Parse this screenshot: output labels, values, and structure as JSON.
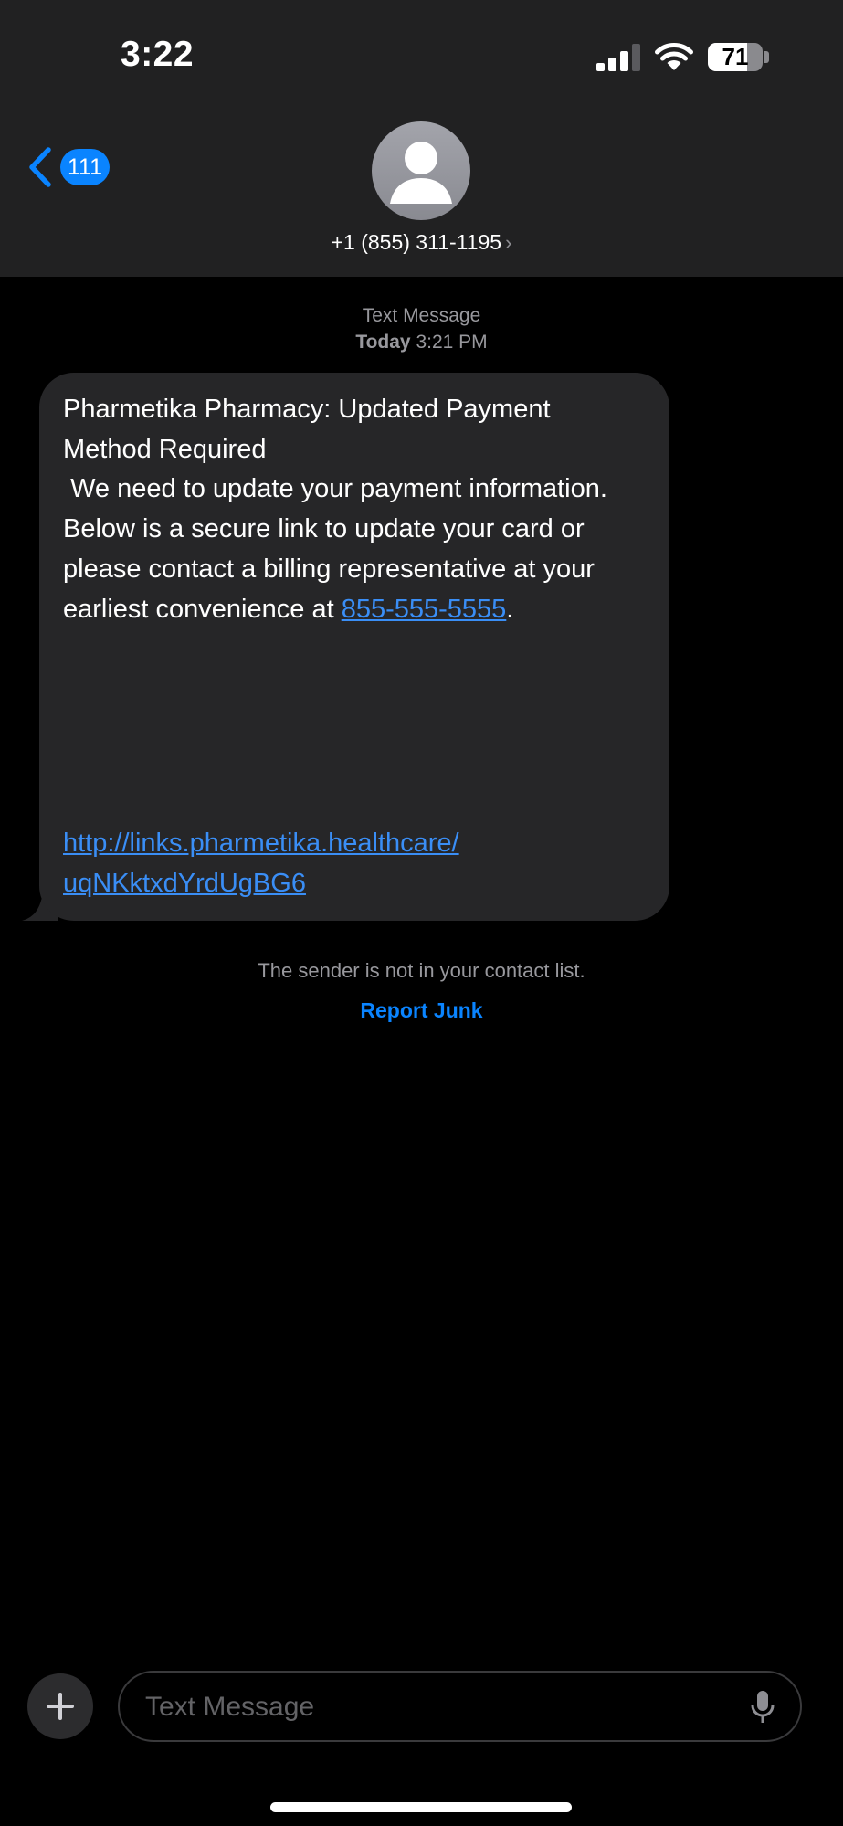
{
  "status_bar": {
    "time": "3:22",
    "battery_level": "71",
    "battery_fraction": 0.71,
    "signal_bars_active": 3,
    "signal_bars_total": 4
  },
  "nav": {
    "back_badge": "111",
    "contact_number": "+1 (855) 311-1195",
    "chevron": "›"
  },
  "conversation": {
    "service": "Text Message",
    "date_label": "Today",
    "time_label": "3:21 PM",
    "message": {
      "line_1": "Pharmetika Pharmacy: Updated Payment Method Required\n We need to update your payment information.  Below is a secure link to update your card or please contact a billing representative at your earliest convenience at ",
      "phone_link": "855-555-5555",
      "after_phone": ".",
      "url_part_1": "http://links.pharmetika.healthcare/",
      "url_part_2": "uqNKktxdYrdUgBG6"
    },
    "sender_notice": "The sender is not in your contact list.",
    "report_label": "Report Junk"
  },
  "composer": {
    "placeholder": "Text Message"
  },
  "colors": {
    "accent": "#0a84ff",
    "header_bg": "#212122",
    "bubble_bg": "#262628",
    "link": "#3a8ef6"
  },
  "icons": [
    "back-chevron-icon",
    "person-icon",
    "signal-icon",
    "wifi-icon",
    "battery-icon",
    "plus-icon",
    "microphone-icon"
  ]
}
